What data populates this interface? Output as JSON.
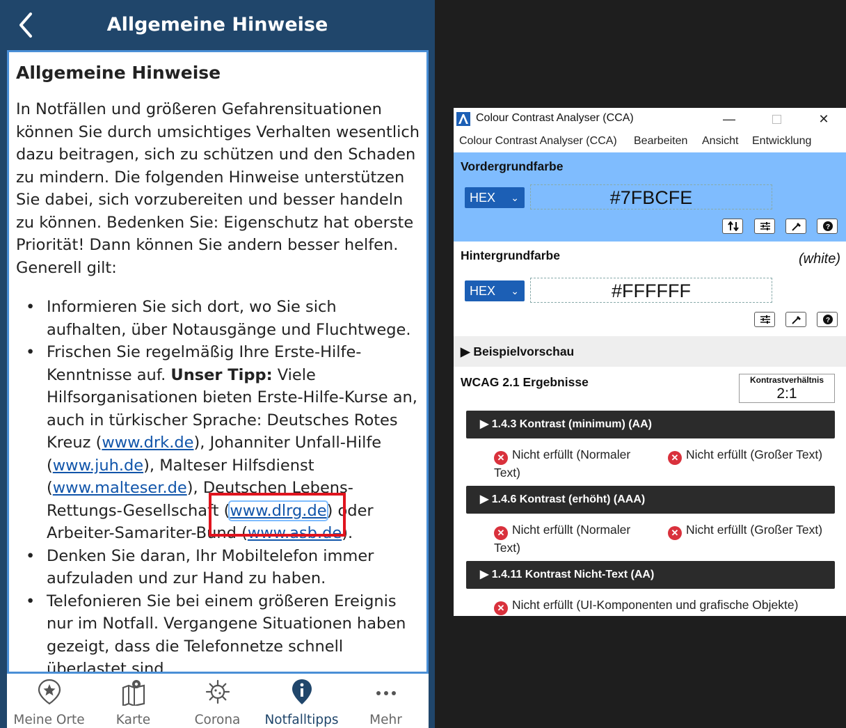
{
  "app": {
    "title": "Allgemeine Hinweise",
    "heading": "Allgemeine Hinweise",
    "intro": "In Notfällen und größeren Gefahrensituationen können Sie durch umsichtiges Verhalten wesentlich dazu beitragen, sich zu schützen und den Schaden zu mindern. Die folgenden Hinweise unterstützen Sie dabei, sich vorzubereiten und besser handeln zu können. Bedenken Sie: Eigenschutz hat oberste Priorität! Dann können Sie andern besser helfen. Generell gilt:",
    "bullet1": "Informieren Sie sich dort, wo Sie sich aufhalten, über Notausgänge und Fluchtwege.",
    "bullet2": {
      "t1": "Frischen Sie regelmäßig Ihre Erste-Hilfe-Kenntnisse auf. ",
      "tip": "Unser Tipp:",
      "t2": " Viele Hilfsorganisationen bieten Erste-Hilfe-Kurse an, auch in türkischer Sprache: Deutsches Rotes Kreuz (",
      "link_drk": "www.drk.de",
      "t3": "), Johanniter Unfall-Hilfe (",
      "link_juh": "www.juh.de",
      "t4": "), Malteser Hilfsdienst (",
      "link_malteser": "www.malteser.de",
      "t5": "), Deutschen Lebens-Rettungs-Gesellschaft (",
      "link_dlrg": "www.dlrg.de",
      "t6": ") oder Arbeiter-Samariter-Bund (",
      "link_asb": "www.asb.de",
      "t7": ")."
    },
    "bullet3": "Denken Sie daran, Ihr Mobiltelefon immer aufzuladen und zur Hand zu haben.",
    "bullet4": "Telefonieren Sie bei einem größeren Ereignis nur im Notfall. Vergangene Situationen haben gezeigt, dass die Telefonnetze schnell überlastet sind.",
    "tabs": [
      {
        "label": "Meine Orte",
        "icon": "location-pin-star-icon"
      },
      {
        "label": "Karte",
        "icon": "map-icon"
      },
      {
        "label": "Corona",
        "icon": "virus-icon"
      },
      {
        "label": "Notfalltipps",
        "icon": "info-pin-icon"
      },
      {
        "label": "Mehr",
        "icon": "more-dots-icon"
      }
    ],
    "colors": {
      "header": "#20466b",
      "active_tab": "#20466b",
      "highlight": "#e0141e"
    }
  },
  "cca": {
    "window_title": "Colour Contrast Analyser (CCA)",
    "menu": [
      "Colour Contrast Analyser (CCA)",
      "Bearbeiten",
      "Ansicht",
      "Entwicklung"
    ],
    "foreground": {
      "label": "Vordergrundfarbe",
      "format": "HEX",
      "value": "#7FBCFE"
    },
    "background": {
      "label": "Hintergrundfarbe",
      "note": "(white)",
      "format": "HEX",
      "value": "#FFFFFF"
    },
    "preview_label": "Beispielvorschau",
    "results_title": "WCAG 2.1 Ergebnisse",
    "ratio_label": "Kontrastverhältnis",
    "ratio_value": "2:1",
    "criteria": [
      {
        "title": "1.4.3 Kontrast (minimum) (AA)",
        "r1": "Nicht erfüllt (Normaler Text)",
        "r2": "Nicht erfüllt (Großer Text)"
      },
      {
        "title": "1.4.6 Kontrast (erhöht) (AAA)",
        "r1": "Nicht erfüllt (Normaler Text)",
        "r2": "Nicht erfüllt (Großer Text)"
      },
      {
        "title": "1.4.11 Kontrast Nicht-Text (AA)",
        "r1": "Nicht erfüllt (UI-Komponenten und grafische Objekte)"
      }
    ],
    "colors": {
      "foreground_swatch": "#7FBCFE",
      "select_bg": "#1c5fb5",
      "fail": "#d9313c"
    }
  }
}
